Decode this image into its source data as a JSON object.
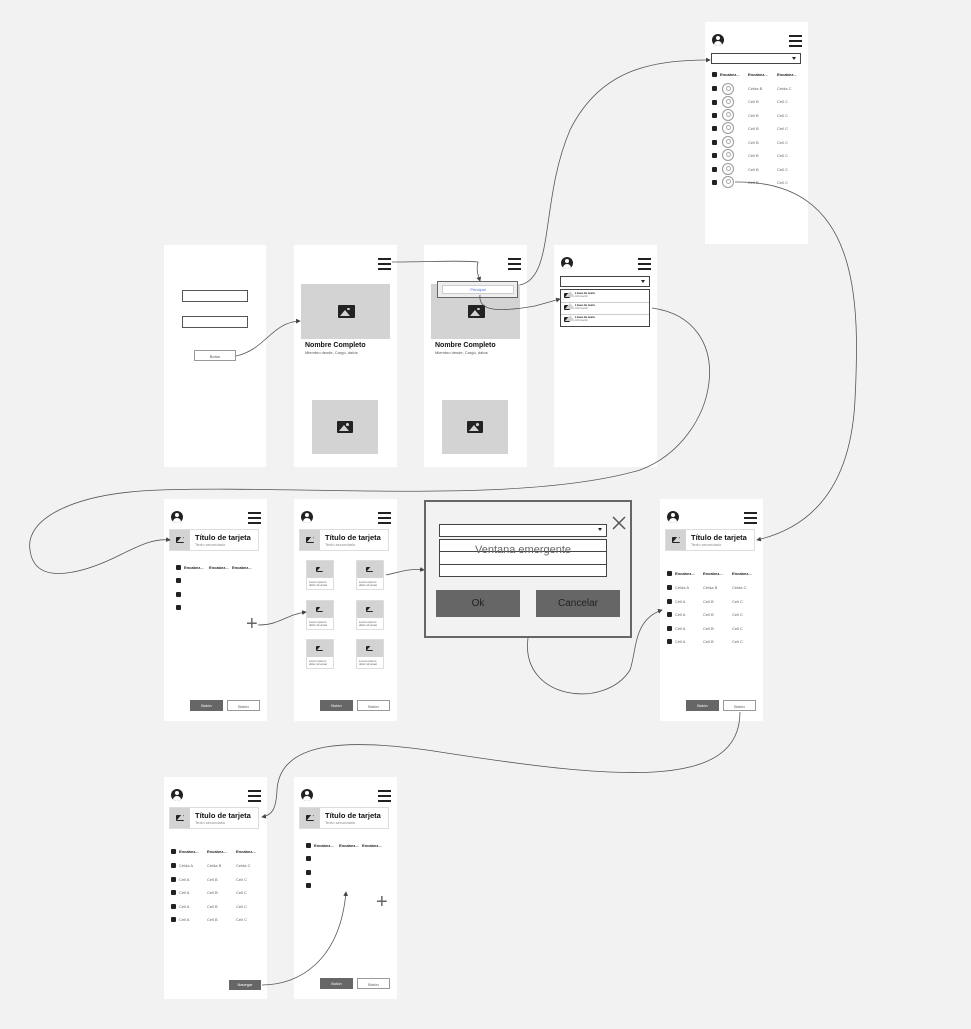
{
  "login": {
    "button_label": "Botón"
  },
  "profile": {
    "name": "Nombre Completo",
    "subtitle": "Miembro desde, Cargo, datos"
  },
  "menu_popup": {
    "item": "Principal"
  },
  "list_screen": {
    "items": [
      {
        "title": "Línea de texto",
        "sub": "Información"
      },
      {
        "title": "Línea de texto",
        "sub": "Información"
      },
      {
        "title": "Línea de texto",
        "sub": "Información"
      }
    ]
  },
  "avatar_table": {
    "headers": [
      "Encabez...",
      "Encabez...",
      "Encabez..."
    ],
    "rows": [
      [
        "Celda B",
        "Celda C"
      ],
      [
        "Cell B",
        "Cell C"
      ],
      [
        "Cell B",
        "Cell C"
      ],
      [
        "Cell B",
        "Cell C"
      ],
      [
        "Cell B",
        "Cell C"
      ],
      [
        "Cell B",
        "Cell C"
      ],
      [
        "Cell B",
        "Cell C"
      ],
      [
        "Cell B",
        "Cell C"
      ]
    ]
  },
  "card": {
    "title": "Título de tarjeta",
    "subtitle": "Texto secundario"
  },
  "table": {
    "headers": [
      "Encabez...",
      "Encabez...",
      "Encabez..."
    ],
    "rows": [
      [
        "Celda A",
        "Celda B",
        "Celda C"
      ],
      [
        "Cell A",
        "Cell B",
        "Cell C"
      ],
      [
        "Cell A",
        "Cell B",
        "Cell C"
      ],
      [
        "Cell A",
        "Cell B",
        "Cell C"
      ],
      [
        "Cell A",
        "Cell B",
        "Cell C"
      ],
      [
        "Cell A",
        "Cell B",
        "Cell C"
      ]
    ]
  },
  "grid_tile_label": "Lorem ipsum dolor sit amet",
  "buttons": {
    "primary": "Botón",
    "secondary": "Botón",
    "navigate": "Navegar"
  },
  "modal": {
    "title": "Ventana emergente",
    "ok": "Ok",
    "cancel": "Cancelar"
  }
}
